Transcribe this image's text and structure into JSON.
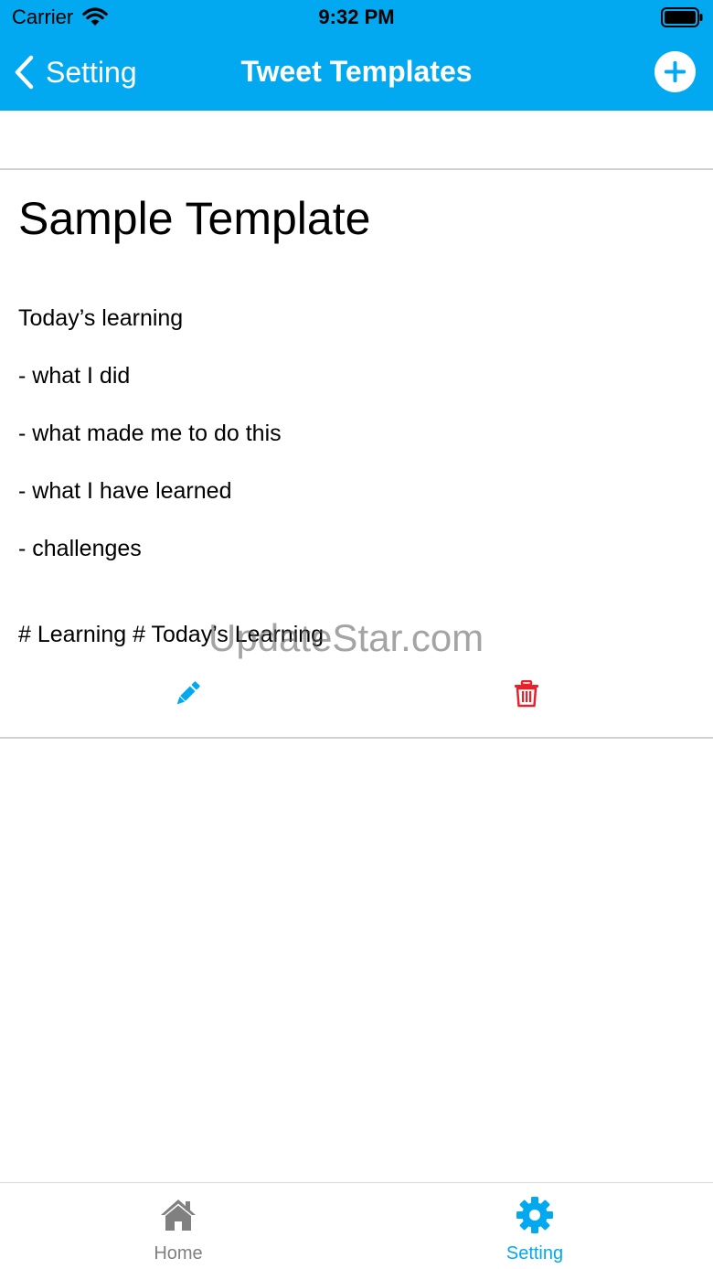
{
  "status_bar": {
    "carrier": "Carrier",
    "time": "9:32 PM"
  },
  "nav": {
    "back_label": "Setting",
    "title": "Tweet Templates"
  },
  "template": {
    "title": "Sample Template",
    "lines": [
      "Today’s learning",
      "- what I did",
      "- what made me to do this",
      "- what I have learned",
      "- challenges"
    ],
    "hashtags": "# Learning # Today’s Learning"
  },
  "watermark": "UpdateStar.com",
  "tabs": [
    {
      "label": "Home",
      "icon": "home-icon",
      "active": false
    },
    {
      "label": "Setting",
      "icon": "gear-icon",
      "active": true
    }
  ],
  "colors": {
    "accent": "#03A9F0",
    "delete": "#E8212B",
    "inactive_tab": "#808080",
    "separator": "#D2D2D2"
  },
  "icons": {
    "back": "chevron-left-icon",
    "add": "plus-circle-icon",
    "edit": "pencil-icon",
    "delete": "trash-icon",
    "wifi": "wifi-icon",
    "battery": "battery-icon"
  }
}
